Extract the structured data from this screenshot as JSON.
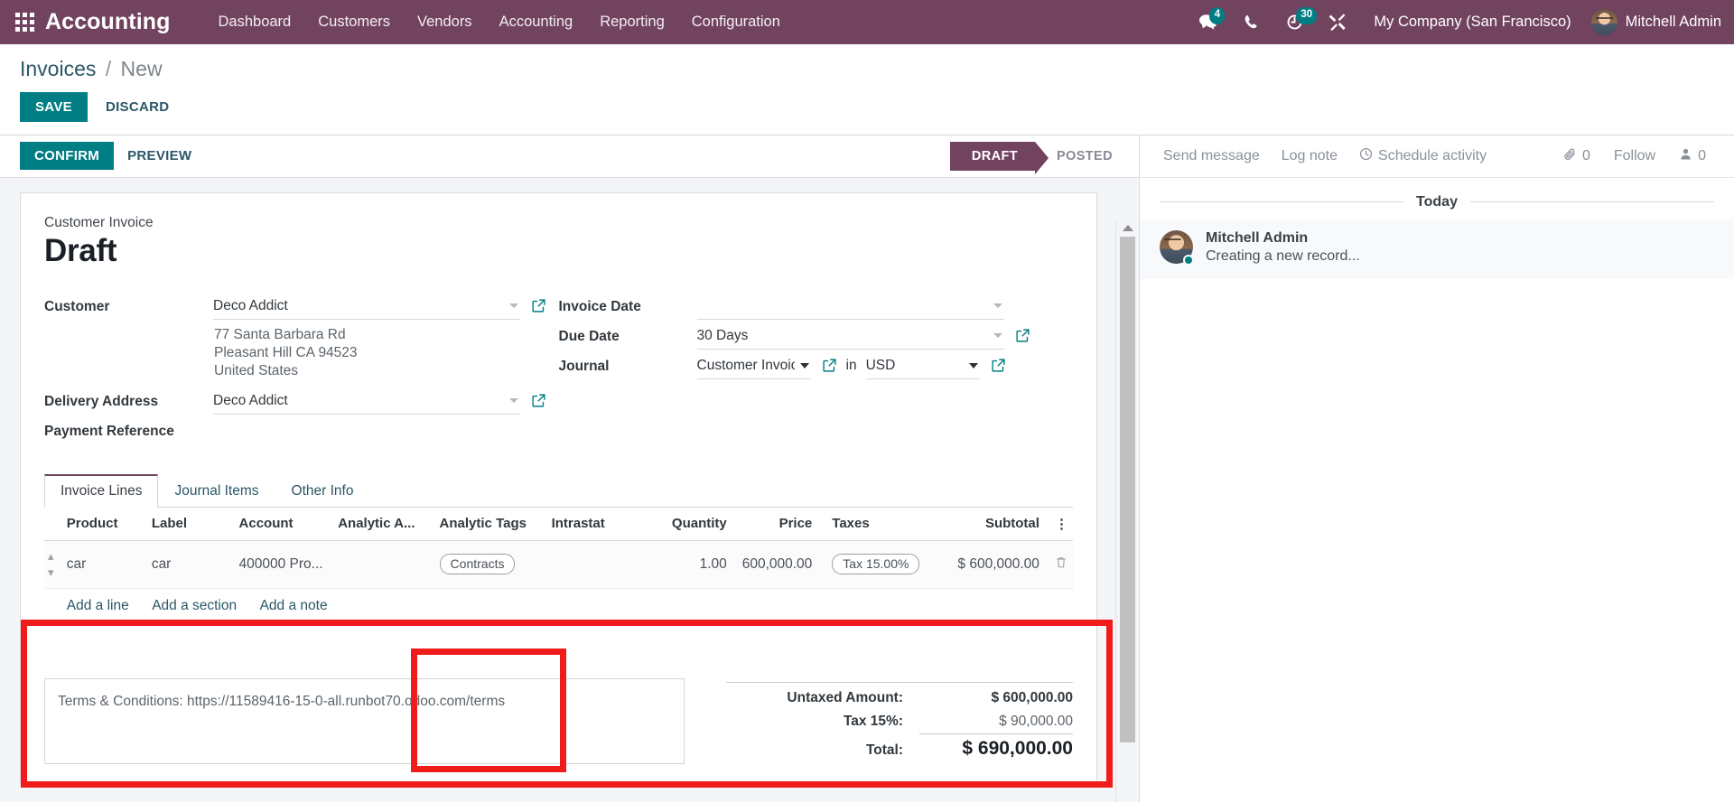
{
  "theme": {
    "brand_purple": "#71435f",
    "accent_teal": "#017e84",
    "annotation_red": "#f01b1b"
  },
  "topbar": {
    "apps_icon": "apps-grid-icon",
    "brand": "Accounting",
    "menus": [
      {
        "label": "Dashboard"
      },
      {
        "label": "Customers"
      },
      {
        "label": "Vendors"
      },
      {
        "label": "Accounting"
      },
      {
        "label": "Reporting"
      },
      {
        "label": "Configuration"
      }
    ],
    "messages_icon": "messages-icon",
    "messages_count": "4",
    "phone_icon": "phone-icon",
    "activities_icon": "clock-icon",
    "activities_count": "30",
    "debug_icon": "wrench-screwdriver-icon",
    "company": "My Company (San Francisco)",
    "user": "Mitchell Admin"
  },
  "breadcrumb": {
    "root": "Invoices",
    "separator": "/",
    "current": "New"
  },
  "control_buttons": {
    "save": "SAVE",
    "discard": "DISCARD"
  },
  "statusbar": {
    "confirm": "CONFIRM",
    "preview": "PREVIEW",
    "stages": [
      {
        "label": "DRAFT",
        "active": true
      },
      {
        "label": "POSTED",
        "active": false
      }
    ]
  },
  "sheet": {
    "document_type": "Customer Invoice",
    "title": "Draft",
    "left_fields": [
      {
        "label": "Customer",
        "value": "Deco Addict"
      },
      {
        "label": "Delivery Address",
        "value": "Deco Addict"
      },
      {
        "label": "Payment Reference",
        "value": ""
      }
    ],
    "customer_address": [
      "77 Santa Barbara Rd",
      "Pleasant Hill CA 94523",
      "United States"
    ],
    "right_fields": {
      "invoice_date_label": "Invoice Date",
      "invoice_date_value": "",
      "due_date_label": "Due Date",
      "due_date_value": "30 Days",
      "journal_label": "Journal",
      "journal_value": "Customer Invoice",
      "in_word": "in",
      "currency_value": "USD"
    }
  },
  "notebook": {
    "tabs": [
      {
        "label": "Invoice Lines",
        "active": true
      },
      {
        "label": "Journal Items",
        "active": false
      },
      {
        "label": "Other Info",
        "active": false
      }
    ],
    "columns": [
      "Product",
      "Label",
      "Account",
      "Analytic A...",
      "Analytic Tags",
      "Intrastat",
      "Quantity",
      "Price",
      "Taxes",
      "Subtotal"
    ],
    "optional_columns_icon": "vertical-dots-icon",
    "rows": [
      {
        "drag_handle": "drag-handle-icon",
        "product": "car",
        "label": "car",
        "account": "400000 Pro...",
        "analytic_account": "",
        "analytic_tags": [
          "Contracts"
        ],
        "intrastat": "",
        "quantity": "1.00",
        "price": "600,000.00",
        "taxes": [
          "Tax 15.00%"
        ],
        "subtotal": "$ 600,000.00",
        "delete_icon": "trash-icon"
      }
    ],
    "add_links": [
      "Add a line",
      "Add a section",
      "Add a note"
    ]
  },
  "bottom": {
    "terms": "Terms & Conditions: https://11589416-15-0-all.runbot70.odoo.com/terms",
    "totals": [
      {
        "label": "Untaxed Amount:",
        "value": "$ 600,000.00",
        "style": "bold"
      },
      {
        "label": "Tax 15%:",
        "value": "$ 90,000.00",
        "style": "muted"
      },
      {
        "label": "Total:",
        "value": "$ 690,000.00",
        "style": "grand"
      }
    ]
  },
  "chatter": {
    "send_message": "Send message",
    "log_note": "Log note",
    "schedule_activity": "Schedule activity",
    "schedule_icon": "clock-icon",
    "attachment_icon": "paperclip-icon",
    "attachment_count": "0",
    "follow": "Follow",
    "followers_icon": "user-icon",
    "followers_count": "0",
    "date_separator": "Today",
    "messages": [
      {
        "author": "Mitchell Admin",
        "body": "Creating a new record...",
        "avatar": "avatar-mitchell-admin"
      }
    ]
  }
}
